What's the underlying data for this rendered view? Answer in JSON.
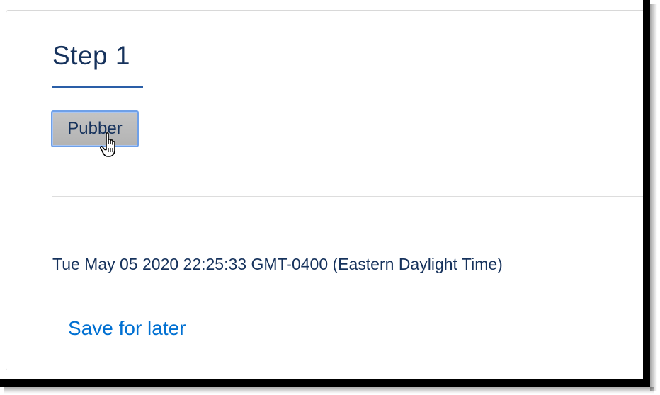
{
  "step": {
    "title": "Step 1"
  },
  "actions": {
    "pubber_label": "Pubber",
    "save_later_label": "Save for later"
  },
  "timestamp": {
    "text": "Tue May 05 2020 22:25:33 GMT-0400 (Eastern Daylight Time)"
  },
  "icons": {
    "cursor": "hand-pointer-icon"
  },
  "colors": {
    "title": "#16325c",
    "underline": "#2a5ea7",
    "link": "#0070d2",
    "button_bg": "#bdbdbd",
    "button_border": "#6fa0e8"
  }
}
